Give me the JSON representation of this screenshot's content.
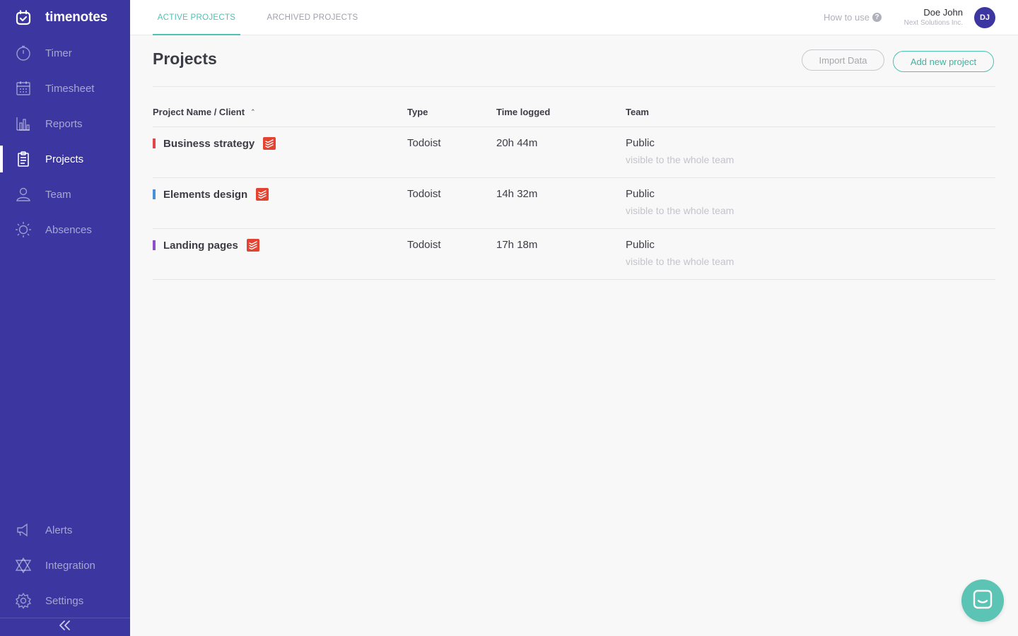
{
  "app": {
    "name": "timenotes"
  },
  "sidebar": {
    "items": [
      {
        "label": "Timer",
        "icon": "stopwatch-icon"
      },
      {
        "label": "Timesheet",
        "icon": "calendar-icon"
      },
      {
        "label": "Reports",
        "icon": "bar-chart-icon"
      },
      {
        "label": "Projects",
        "icon": "clipboard-icon",
        "active": true
      },
      {
        "label": "Team",
        "icon": "user-icon"
      },
      {
        "label": "Absences",
        "icon": "sun-icon"
      }
    ],
    "bottom_items": [
      {
        "label": "Alerts",
        "icon": "megaphone-icon"
      },
      {
        "label": "Integration",
        "icon": "integration-icon"
      },
      {
        "label": "Settings",
        "icon": "gear-icon"
      }
    ],
    "collapse_icon": "double-chevron-left-icon"
  },
  "header": {
    "tabs": [
      {
        "label": "ACTIVE PROJECTS",
        "active": true
      },
      {
        "label": "ARCHIVED PROJECTS",
        "active": false
      }
    ],
    "how_to_use": "How to use",
    "user": {
      "name": "Doe John",
      "org": "Next Solutions Inc.",
      "initials": "DJ"
    }
  },
  "main": {
    "title": "Projects",
    "import_label": "Import Data",
    "add_label": "Add new project",
    "columns": [
      "Project Name / Client",
      "Type",
      "Time logged",
      "Team"
    ],
    "rows": [
      {
        "name": "Business strategy",
        "color": "#e0474c",
        "type": "Todoist",
        "time": "20h 44m",
        "team": "Public",
        "team_sub": "visible to the whole team"
      },
      {
        "name": "Elements design",
        "color": "#4a90d9",
        "type": "Todoist",
        "time": "14h 32m",
        "team": "Public",
        "team_sub": "visible to the whole team"
      },
      {
        "name": "Landing pages",
        "color": "#8e4fc9",
        "type": "Todoist",
        "time": "17h 18m",
        "team": "Public",
        "team_sub": "visible to the whole team"
      }
    ]
  },
  "colors": {
    "sidebar": "#3b36a0",
    "accent": "#4cc2b0",
    "todoist": "#e44332"
  }
}
